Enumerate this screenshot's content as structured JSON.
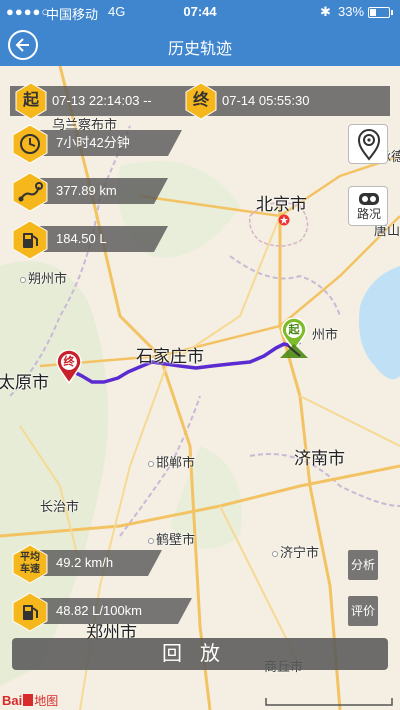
{
  "status_bar": {
    "signal": "●●●●○",
    "carrier": "中国移动",
    "network": "4G",
    "time": "07:44",
    "bluetooth": "✱",
    "battery": "33%"
  },
  "header": {
    "title": "历史轨迹"
  },
  "trip": {
    "start_badge": "起",
    "start_time": "07-13 22:14:03 --",
    "end_badge": "终",
    "end_time": "07-14 05:55:30",
    "duration": "7小时42分钟",
    "distance": "377.89 km",
    "fuel": "184.50 L",
    "avg_speed_label": "平均\n车速",
    "avg_speed": "49.2 km/h",
    "avg_fuel": "48.82 L/100km"
  },
  "map_controls": {
    "traffic_label": "路况",
    "analysis_label": "分析",
    "evaluate_label": "评价"
  },
  "cities": {
    "wulanchabu": "乌兰察布市",
    "beijing": "北京市",
    "chengde": "承德",
    "tangshan": "唐山",
    "shuozhou": "朔州市",
    "cangzhou": "州市",
    "shijiazhuang": "石家庄市",
    "taiyuan": "太原市",
    "handan": "邯郸市",
    "jinan": "济南市",
    "changzhi": "长治市",
    "hebi": "鹤壁市",
    "jining": "济宁市",
    "zhengzhou": "郑州市",
    "shangqiu": "商丘市"
  },
  "route": {
    "start_marker": "起",
    "end_marker": "终"
  },
  "replay_button": "回放",
  "baidu_logo": "Bai",
  "baidu_map_text": "地图",
  "colors": {
    "primary": "#3f86cf",
    "badge_yellow": "#f5b71b",
    "route": "#5a2bd1",
    "start_marker": "#7dbb2b",
    "end_marker": "#c8202a"
  }
}
